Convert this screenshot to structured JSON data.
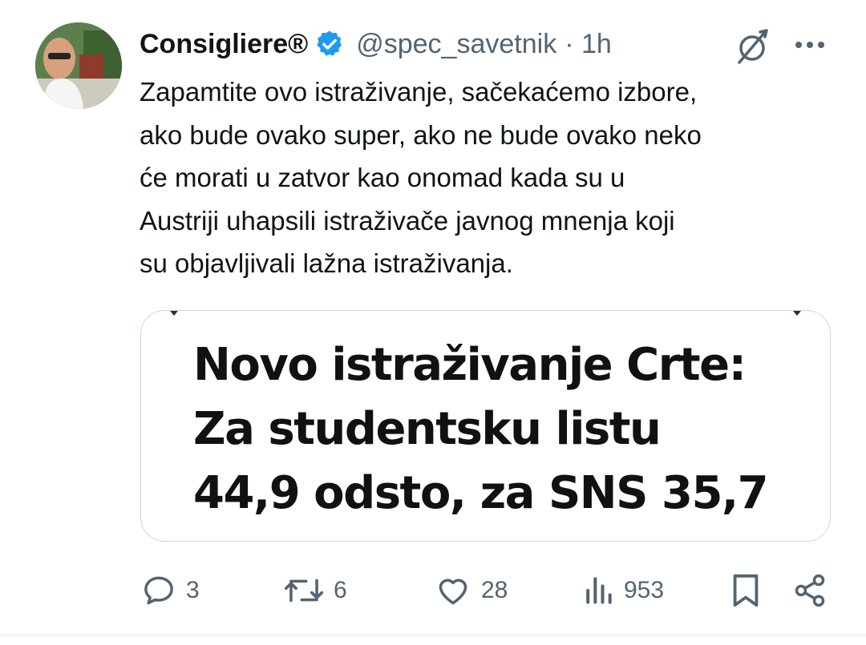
{
  "author": {
    "name": "Consigliere®",
    "handle": "@spec_savetnik",
    "time": "· 1h",
    "verified": true
  },
  "tweet": {
    "lines": [
      "Zapamtite ovo istraživanje, sačekaćemo izbore,",
      "ako bude ovako super, ako ne bude ovako neko",
      "će morati u zatvor kao onomad kada su u",
      "Austriji uhapsili istraživače javnog mnenja koji",
      "su objavljivali lažna istraživanja."
    ]
  },
  "media": {
    "headline_lines": [
      "Novo istraživanje Crte:",
      "Za studentsku listu",
      "44,9 odsto, za SNS 35,7"
    ]
  },
  "actions": {
    "replies": "3",
    "reposts": "6",
    "likes": "28",
    "views": "953"
  },
  "icons": {
    "header": [
      "verified-badge-icon",
      "grok-icon",
      "more-icon"
    ],
    "actions": [
      "reply-icon",
      "repost-icon",
      "like-icon",
      "views-icon",
      "bookmark-icon",
      "share-icon"
    ]
  },
  "colors": {
    "verified": "#1d9bf0",
    "text": "#0f1419",
    "secondary": "#536471",
    "border": "#cfd9de"
  }
}
